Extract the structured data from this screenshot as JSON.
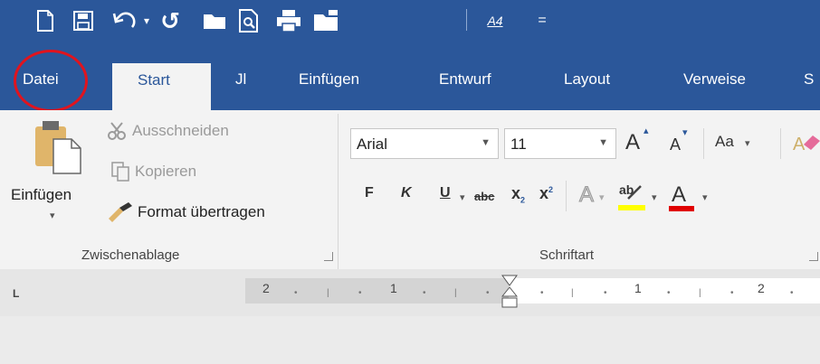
{
  "quick_access": {
    "icons": [
      "new-document-icon",
      "save-icon",
      "undo-icon",
      "redo-icon",
      "open-folder-icon",
      "print-preview-icon",
      "print-icon",
      "folder-icon",
      "font-size-icon",
      "customize-icon"
    ],
    "redo_glyph": "↺",
    "font_icon_label": "A4",
    "customize_glyph": "="
  },
  "tabs": {
    "file": "Datei",
    "start": "Start",
    "jl": "Jl",
    "insert": "Einfügen",
    "design": "Entwurf",
    "layout": "Layout",
    "references": "Verweise",
    "partial": "S"
  },
  "clipboard": {
    "paste": "Einfügen",
    "cut": "Ausschneiden",
    "copy": "Kopieren",
    "format_painter": "Format übertragen",
    "group_label": "Zwischenablage"
  },
  "font": {
    "font_name": "Arial",
    "font_size": "11",
    "grow": "A",
    "shrink": "A",
    "change_case": "Aa",
    "bold": "F",
    "italic": "K",
    "underline": "U",
    "strikethrough": "abc",
    "subscript": "x",
    "subscript_mark": "2",
    "superscript": "x",
    "superscript_mark": "2",
    "text_effects": "A",
    "highlight": "ab",
    "font_color": "A",
    "group_label": "Schriftart",
    "highlight_color": "#ffff00",
    "font_color_bar": "#e00000"
  },
  "ruler": {
    "corner": "L",
    "numbers": [
      "2",
      "1",
      "1",
      "2"
    ]
  },
  "colors": {
    "accent": "#2b579a",
    "circle": "#e0141e"
  }
}
